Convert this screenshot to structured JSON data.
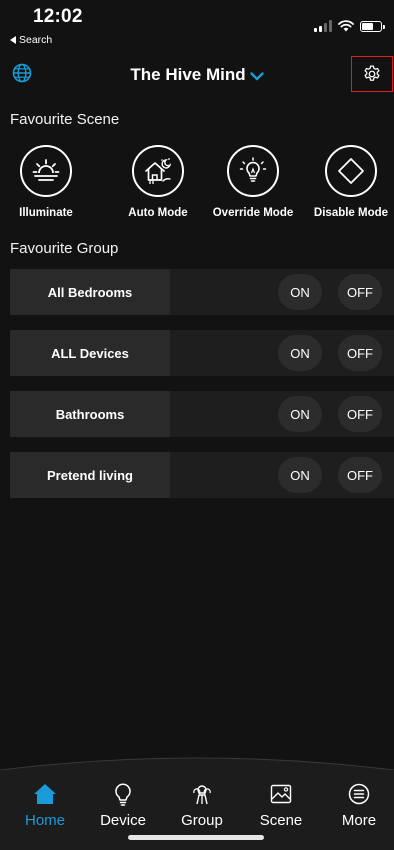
{
  "status_bar": {
    "time": "12:02",
    "back_label": "Search"
  },
  "header": {
    "title": "The Hive Mind",
    "accent_color": "#1a9bd8",
    "left_icon": "globe-icon",
    "right_icon": "gear-icon"
  },
  "favourite_scene": {
    "title": "Favourite Scene",
    "items": [
      {
        "label": "Illuminate",
        "icon": "sunrise-icon"
      },
      {
        "label": "Auto Mode",
        "icon": "house-moon-icon"
      },
      {
        "label": "Override Mode",
        "icon": "lightbulb-icon"
      },
      {
        "label": "Disable Mode",
        "icon": "diamond-icon"
      }
    ]
  },
  "favourite_group": {
    "title": "Favourite Group",
    "on_label": "ON",
    "off_label": "OFF",
    "items": [
      {
        "name": "All Bedrooms"
      },
      {
        "name": "ALL Devices"
      },
      {
        "name": "Bathrooms"
      },
      {
        "name": "Pretend living"
      }
    ]
  },
  "bottom_nav": {
    "active_color": "#1a9bd8",
    "items": [
      {
        "label": "Home",
        "icon": "home-icon",
        "active": true
      },
      {
        "label": "Device",
        "icon": "bulb-outline-icon",
        "active": false
      },
      {
        "label": "Group",
        "icon": "group-icon",
        "active": false
      },
      {
        "label": "Scene",
        "icon": "picture-icon",
        "active": false
      },
      {
        "label": "More",
        "icon": "list-circle-icon",
        "active": false
      }
    ]
  }
}
